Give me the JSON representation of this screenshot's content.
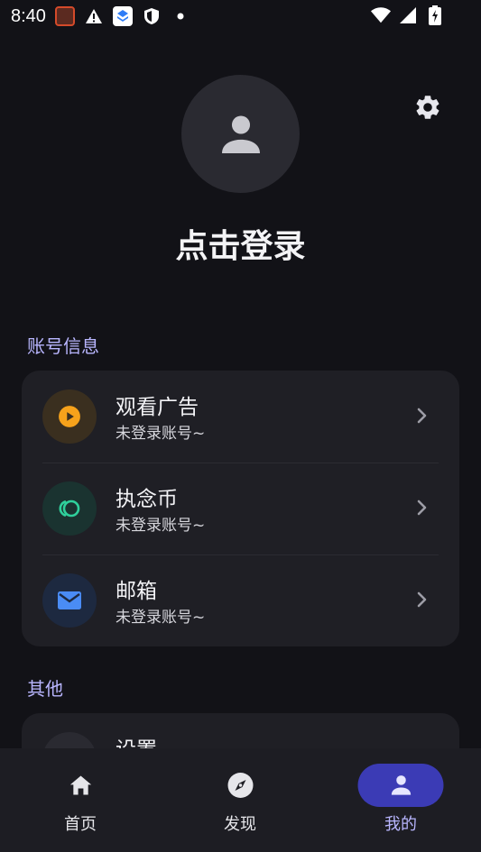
{
  "status_bar": {
    "time": "8:40",
    "left_icons": [
      "app-notification-icon",
      "warning-icon",
      "layers-app-icon",
      "shield-icon",
      "dot-icon"
    ],
    "right_icons": [
      "wifi-icon",
      "cellular-icon",
      "battery-charging-icon"
    ]
  },
  "profile": {
    "login_text": "点击登录"
  },
  "sections": {
    "account_label": "账号信息",
    "other_label": "其他"
  },
  "account_items": [
    {
      "title": "观看广告",
      "subtitle": "未登录账号~",
      "icon": "play-circle-icon",
      "color": "#f6a21b"
    },
    {
      "title": "执念币",
      "subtitle": "未登录账号~",
      "icon": "coin-rings-icon",
      "color": "#2fcf9b"
    },
    {
      "title": "邮箱",
      "subtitle": "未登录账号~",
      "icon": "mail-icon",
      "color": "#4a8cf5"
    }
  ],
  "other_items": [
    {
      "title": "设置"
    }
  ],
  "bottom_nav": [
    {
      "label": "首页",
      "icon": "home-icon",
      "active": false
    },
    {
      "label": "发现",
      "icon": "compass-icon",
      "active": false
    },
    {
      "label": "我的",
      "icon": "person-icon",
      "active": true
    }
  ],
  "colors": {
    "background": "#121217",
    "card": "#1f1f25",
    "accent": "#b9b6ff",
    "active_pill": "#3b3bb5"
  }
}
